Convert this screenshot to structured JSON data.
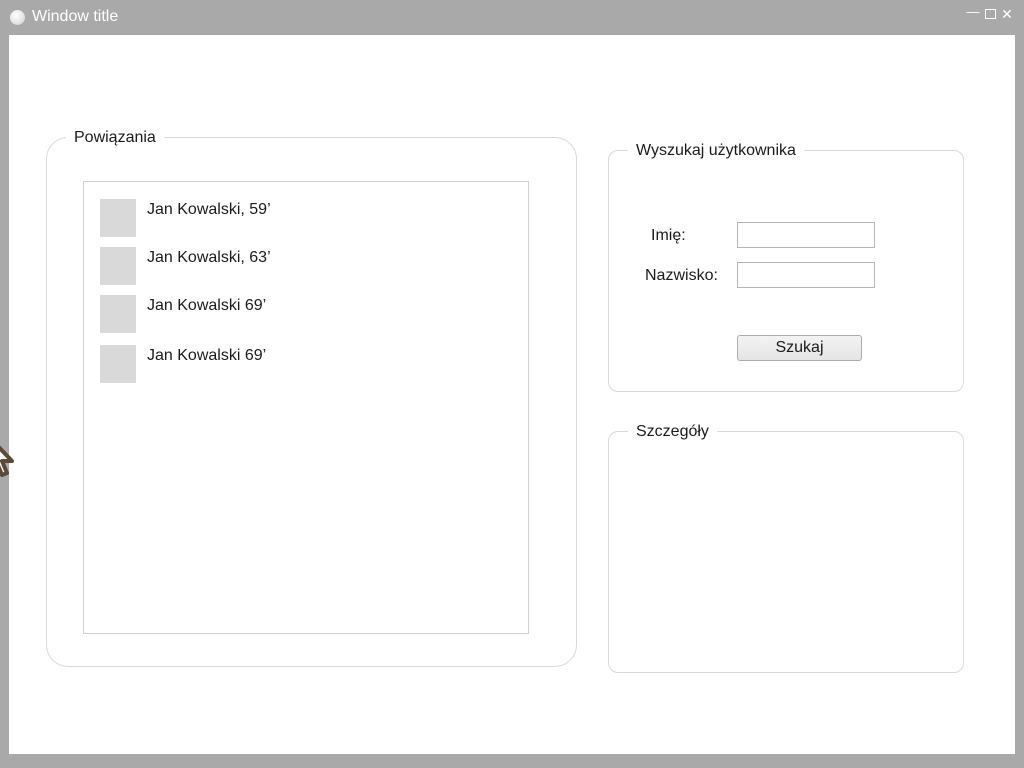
{
  "window": {
    "title": "Window title",
    "minimize_glyph": "—",
    "close_glyph": "✕"
  },
  "links_group": {
    "legend": "Powiązania",
    "items": [
      {
        "label": "Jan Kowalski, 59’"
      },
      {
        "label": " Jan Kowalski, 63’"
      },
      {
        "label": "Jan Kowalski 69’"
      },
      {
        "label": "Jan Kowalski 69’"
      }
    ]
  },
  "search_group": {
    "legend": "Wyszukaj użytkownika",
    "first_name_label": "Imię:",
    "first_name_value": "",
    "last_name_label": "Nazwisko:",
    "last_name_value": "",
    "search_button_label": "Szukaj"
  },
  "details_group": {
    "legend": "Szczegóły"
  },
  "colors": {
    "frame": "#a9a9a9",
    "client_background": "#ffffff",
    "border": "#d9d9d9",
    "thumbnail": "#d9d9d9"
  }
}
